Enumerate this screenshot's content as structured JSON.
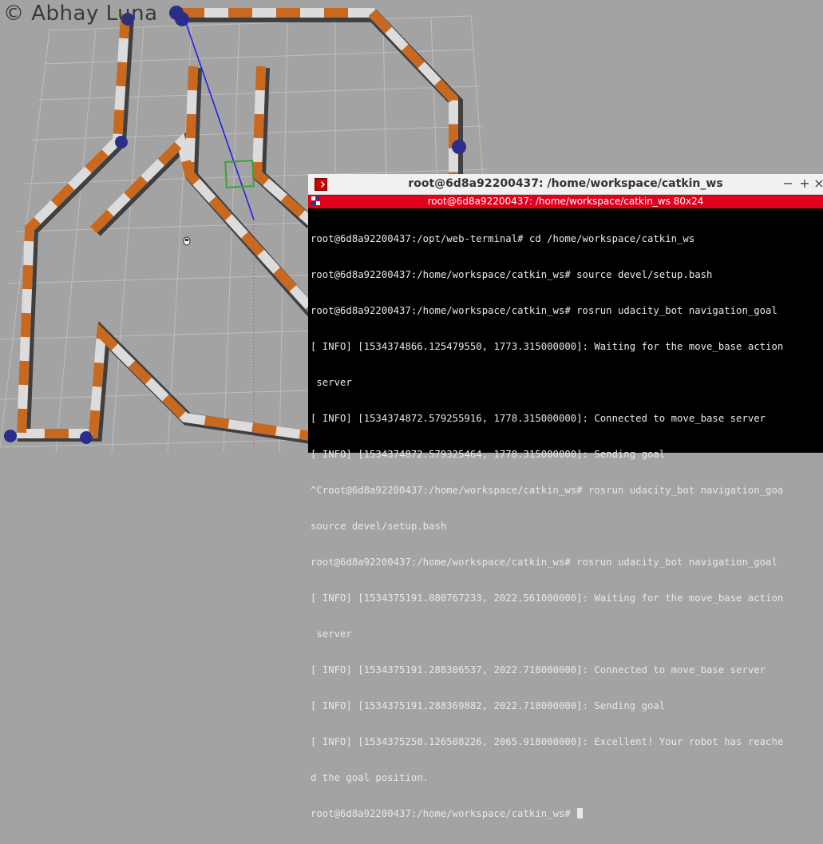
{
  "watermark": "© Abhay Luna",
  "scene": {
    "label": "rviz 3D view of navigation map",
    "icon": "robot-arena-icon"
  },
  "terminal": {
    "window_title": "root@6d8a92200437: /home/workspace/catkin_ws",
    "tab_title": "root@6d8a92200437: /home/workspace/catkin_ws 80x24",
    "buttons": {
      "minimize": "−",
      "maximize": "+",
      "close": "×"
    },
    "lines": [
      "root@6d8a92200437:/opt/web-terminal# cd /home/workspace/catkin_ws",
      "root@6d8a92200437:/home/workspace/catkin_ws# source devel/setup.bash",
      "root@6d8a92200437:/home/workspace/catkin_ws# rosrun udacity_bot navigation_goal",
      "[ INFO] [1534374866.125479550, 1773.315000000]: Waiting for the move_base action",
      " server",
      "[ INFO] [1534374872.579255916, 1778.315000000]: Connected to move_base server",
      "[ INFO] [1534374872.579325464, 1778.315000000]: Sending goal",
      "^Croot@6d8a92200437:/home/workspace/catkin_ws# rosrun udacity_bot navigation_goa",
      "source devel/setup.bash",
      "root@6d8a92200437:/home/workspace/catkin_ws# rosrun udacity_bot navigation_goal",
      "[ INFO] [1534375191.080767233, 2022.561000000]: Waiting for the move_base action",
      " server",
      "[ INFO] [1534375191.288306537, 2022.718000000]: Connected to move_base server",
      "[ INFO] [1534375191.288369882, 2022.718000000]: Sending goal",
      "[ INFO] [1534375250.126508226, 2065.918000000]: Excellent! Your robot has reache",
      "d the goal position.",
      "root@6d8a92200437:/home/workspace/catkin_ws# "
    ]
  },
  "colors": {
    "background": "#a3a3a3",
    "wall_orange": "#c8691f",
    "wall_white": "#dcdcdc",
    "post_blue": "#2a2e8a",
    "path_blue": "#1a1aee",
    "goal_green": "#3aa23a",
    "terminal_tab_red": "#e0001b"
  }
}
